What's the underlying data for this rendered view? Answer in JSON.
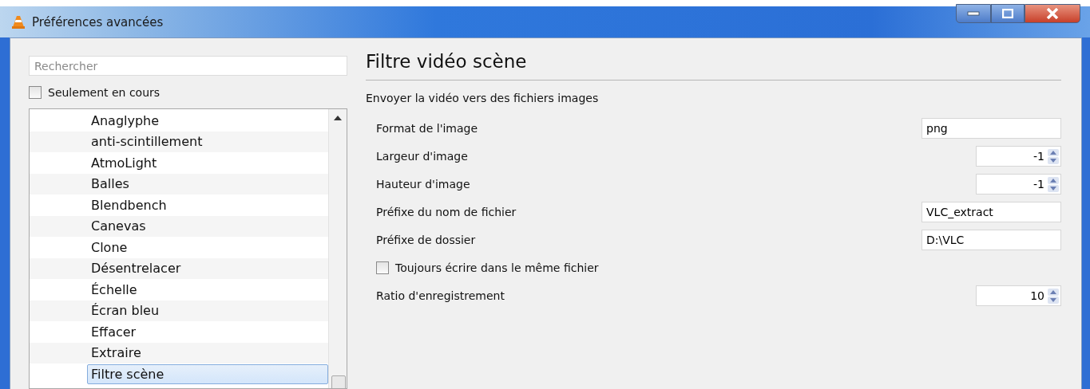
{
  "window": {
    "title": "Préférences avancées"
  },
  "search": {
    "placeholder": "Rechercher"
  },
  "only_current": {
    "label": "Seulement en cours",
    "checked": false
  },
  "tree_items": [
    {
      "label": "Anaglyphe",
      "selected": false
    },
    {
      "label": "anti-scintillement",
      "selected": false
    },
    {
      "label": "AtmoLight",
      "selected": false
    },
    {
      "label": "Balles",
      "selected": false
    },
    {
      "label": "Blendbench",
      "selected": false
    },
    {
      "label": "Canevas",
      "selected": false
    },
    {
      "label": "Clone",
      "selected": false
    },
    {
      "label": "Désentrelacer",
      "selected": false
    },
    {
      "label": "Échelle",
      "selected": false
    },
    {
      "label": "Écran bleu",
      "selected": false
    },
    {
      "label": "Effacer",
      "selected": false
    },
    {
      "label": "Extraire",
      "selected": false
    },
    {
      "label": "Filtre scène",
      "selected": true
    }
  ],
  "panel": {
    "title": "Filtre vidéo scène",
    "description": "Envoyer la vidéo vers des fichiers images"
  },
  "settings": [
    {
      "kind": "text",
      "label": "Format de l'image",
      "value": "png"
    },
    {
      "kind": "spin",
      "label": "Largeur d'image",
      "value": "-1"
    },
    {
      "kind": "spin",
      "label": "Hauteur d'image",
      "value": "-1"
    },
    {
      "kind": "text",
      "label": "Préfixe du nom de fichier",
      "value": "VLC_extract"
    },
    {
      "kind": "text",
      "label": "Préfixe de dossier",
      "value": "D:\\VLC"
    },
    {
      "kind": "checkbox",
      "label": "Toujours écrire dans le même fichier",
      "checked": false
    },
    {
      "kind": "spin",
      "label": "Ratio d'enregistrement",
      "value": "10"
    }
  ]
}
